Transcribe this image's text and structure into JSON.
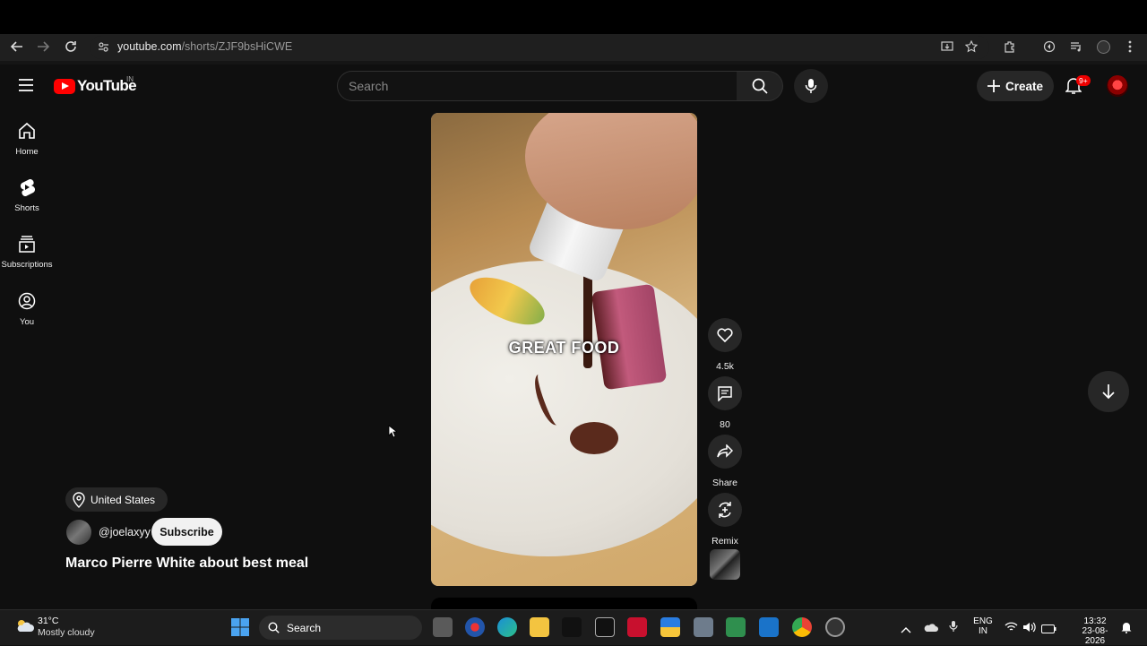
{
  "browser": {
    "url_host": "youtube.com",
    "url_path": "/shorts/ZJF9bsHiCWE"
  },
  "header": {
    "logo_text": "YouTube",
    "country_code": "IN",
    "search_placeholder": "Search",
    "create_label": "Create",
    "notification_count": "9+"
  },
  "sidebar": {
    "items": [
      {
        "label": "Home",
        "icon": "home-icon"
      },
      {
        "label": "Shorts",
        "icon": "shorts-icon"
      },
      {
        "label": "Subscriptions",
        "icon": "subscriptions-icon"
      },
      {
        "label": "You",
        "icon": "account-icon"
      }
    ]
  },
  "video": {
    "caption": "GREAT FOOD",
    "title": "Marco Pierre White about best meal",
    "location": "United States",
    "channel_handle": "@joelaxyy",
    "subscribe_label": "Subscribe"
  },
  "actions": {
    "like_count": "4.5k",
    "comment_count": "80",
    "share_label": "Share",
    "remix_label": "Remix"
  },
  "taskbar": {
    "weather_temp": "31°C",
    "weather_desc": "Mostly cloudy",
    "search_label": "Search",
    "lang_1": "ENG",
    "lang_2": "IN",
    "time": "13:32",
    "date": "23-08-2026"
  },
  "colors": {
    "background": "#0f0f0f",
    "youtube_red": "#ff0000",
    "chip": "#272727"
  }
}
